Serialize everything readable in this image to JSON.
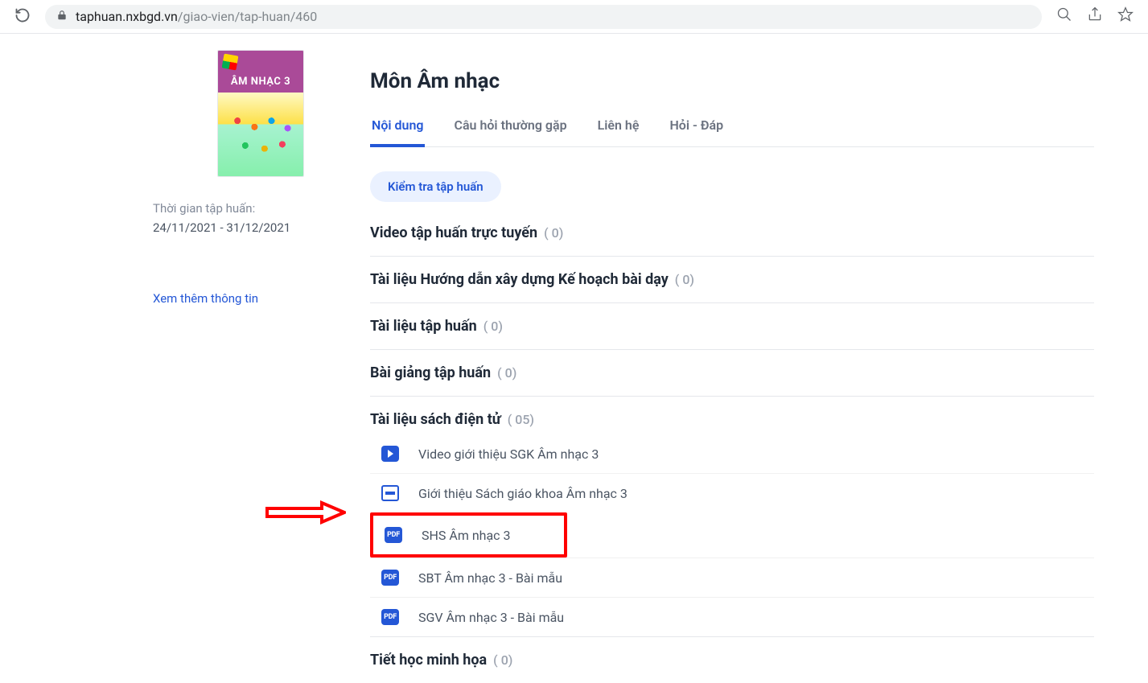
{
  "browser": {
    "host": "taphuan.nxbgd.vn",
    "path": "/giao-vien/tap-huan/460"
  },
  "cover": {
    "label": "ÂM NHẠC 3"
  },
  "sidebar": {
    "time_label": "Thời gian tập huấn:",
    "time_value": "24/11/2021 - 31/12/2021",
    "more_link": "Xem thêm thông tin"
  },
  "page": {
    "title": "Môn Âm nhạc",
    "tabs": [
      {
        "label": "Nội dung",
        "active": true
      },
      {
        "label": "Câu hỏi thường gặp"
      },
      {
        "label": "Liên hệ"
      },
      {
        "label": "Hỏi - Đáp"
      }
    ],
    "action_button": "Kiểm tra tập huấn"
  },
  "sections": [
    {
      "title": "Video tập huấn trực tuyến",
      "count": "( 0)"
    },
    {
      "title": "Tài liệu Hướng dẫn xây dựng Kế hoạch bài dạy",
      "count": "( 0)"
    },
    {
      "title": "Tài liệu tập huấn",
      "count": "( 0)"
    },
    {
      "title": "Bài giảng tập huấn",
      "count": "( 0)"
    },
    {
      "title": "Tài liệu sách điện tử",
      "count": "( 05)",
      "items": [
        {
          "type": "video",
          "label": "Video giới thiệu SGK Âm nhạc 3"
        },
        {
          "type": "slide",
          "label": "Giới thiệu Sách giáo khoa Âm nhạc 3"
        },
        {
          "type": "pdf",
          "label": "SHS Âm nhạc 3",
          "highlight": true
        },
        {
          "type": "pdf",
          "label": "SBT Âm nhạc 3 - Bài mẫu"
        },
        {
          "type": "pdf",
          "label": "SGV Âm nhạc 3 - Bài mẫu"
        }
      ]
    },
    {
      "title": "Tiết học minh họa",
      "count": "( 0)"
    }
  ],
  "icon_text": {
    "pdf": "PDF"
  }
}
